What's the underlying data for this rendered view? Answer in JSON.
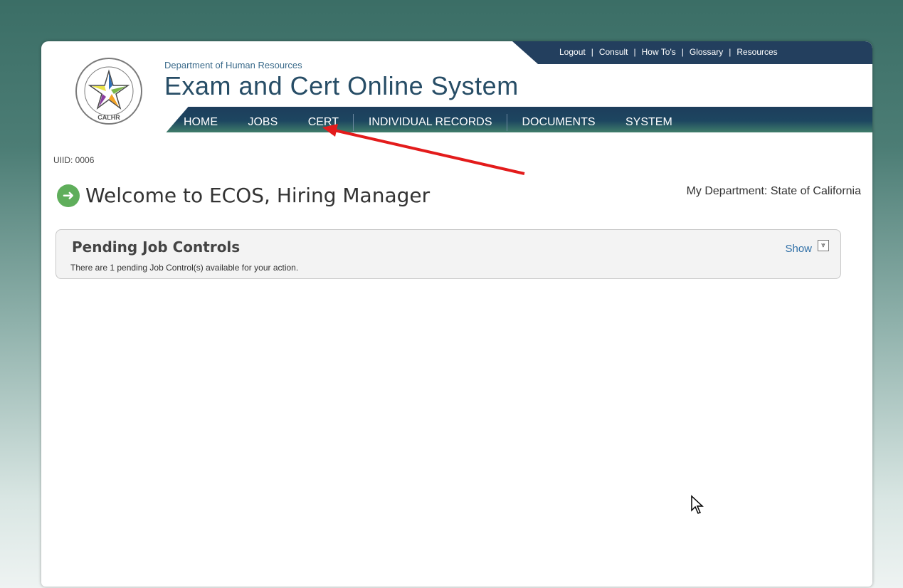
{
  "header": {
    "department": "Department of Human Resources",
    "system_title": "Exam and Cert Online System",
    "seal_text": "CALHR",
    "top_links": [
      "Logout",
      "Consult",
      "How To's",
      "Glossary",
      "Resources"
    ],
    "nav": [
      "HOME",
      "JOBS",
      "CERT",
      "INDIVIDUAL RECORDS",
      "DOCUMENTS",
      "SYSTEM"
    ]
  },
  "content": {
    "uiid": "UIID: 0006",
    "welcome": "Welcome to ECOS, Hiring Manager",
    "my_department": "My Department:  State of California"
  },
  "panel": {
    "title": "Pending Job Controls",
    "message": "There are 1 pending Job Control(s) available for your action.",
    "show_label": "Show"
  },
  "colors": {
    "accent_arrow": "#e31b1b",
    "nav_dark": "#1d3d5c",
    "link_blue": "#2f6fa7",
    "welcome_icon": "#5fae5b"
  },
  "icons": {
    "welcome": "arrow-circle-right-icon",
    "toggle": "chevron-double-down-icon",
    "cursor": "mouse-pointer-icon"
  }
}
